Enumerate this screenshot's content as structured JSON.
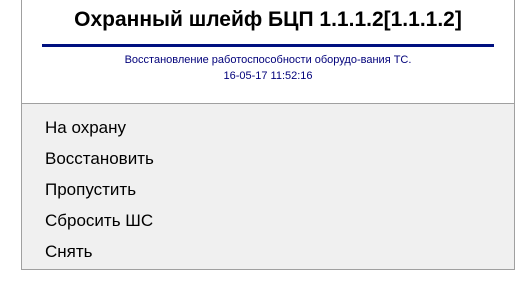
{
  "header": {
    "title": "Охранный шлейф БЦП 1.1.1.2[1.1.1.2]",
    "status_line": "Восстановление работоспособности оборудо-вания ТС.",
    "timestamp": "16-05-17 11:52:16"
  },
  "menu": {
    "items": [
      {
        "label": "На охрану"
      },
      {
        "label": "Восстановить"
      },
      {
        "label": "Пропустить"
      },
      {
        "label": "Сбросить ШС"
      },
      {
        "label": "Снять"
      }
    ]
  },
  "colors": {
    "title_rule": "#001080",
    "subtitle_text": "#00007a",
    "menu_background": "#f0f0f0"
  }
}
